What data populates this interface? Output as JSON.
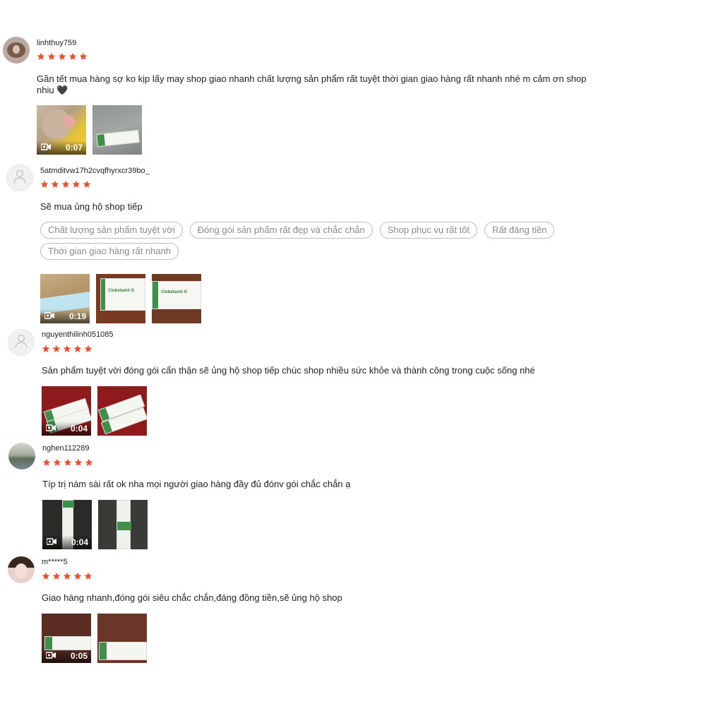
{
  "rating_color": "#ee4d2d",
  "icons": {
    "star": "star-icon",
    "video": "video-camera-icon",
    "avatar_default": "user-silhouette-icon"
  },
  "reviews": [
    {
      "username": "linhthuy759",
      "rating": 5,
      "comment": "Gần tết mua hàng sợ ko kịp lấy may shop giao nhanh chất lượng sản phẩm rất tuyệt thời gian giao hàng rất nhanh nhé m cảm ơn shop nhiu 🖤",
      "tags": [],
      "media": [
        {
          "type": "video",
          "duration": "0:07"
        },
        {
          "type": "image"
        }
      ]
    },
    {
      "username": "5atmditvw17h2cvqfhyrxcr39bo_",
      "rating": 5,
      "comment": "Sẽ mua ủng hộ shop tiếp",
      "tags": [
        "Chất lượng sản phẩm tuyệt vời",
        "Đóng gói sản phẩm rất đẹp và chắc chắn",
        "Shop phục vụ rất tốt",
        "Rất đáng tiền",
        "Thời gian giao hàng rất nhanh"
      ],
      "media": [
        {
          "type": "video",
          "duration": "0:19"
        },
        {
          "type": "image",
          "label": "Clobetamil G"
        },
        {
          "type": "image",
          "label": "Clobetamil G"
        }
      ]
    },
    {
      "username": "nguyenthilinh051085",
      "rating": 5,
      "comment": "Sản phẩm tuyệt vời đóng gói cẩn thận sẽ ủng hộ shop tiếp chúc shop nhiều sức khỏe và thành công trong cuộc sống nhé",
      "tags": [],
      "media": [
        {
          "type": "video",
          "duration": "0:04"
        },
        {
          "type": "image"
        }
      ]
    },
    {
      "username": "nghen112289",
      "rating": 5,
      "comment": "Típ trị nám sài rất ok nha mọi người giao hàng đầy đủ đónv gói chắc chắn ạ",
      "tags": [],
      "media": [
        {
          "type": "video",
          "duration": "0:04"
        },
        {
          "type": "image"
        }
      ]
    },
    {
      "username": "m*****5",
      "rating": 5,
      "comment": "Giao hàng nhanh,đóng gói siêu chắc chắn,đáng đồng tiền,sẽ ủng hộ shop",
      "tags": [],
      "media": [
        {
          "type": "video",
          "duration": "0:05"
        },
        {
          "type": "image"
        }
      ]
    }
  ]
}
